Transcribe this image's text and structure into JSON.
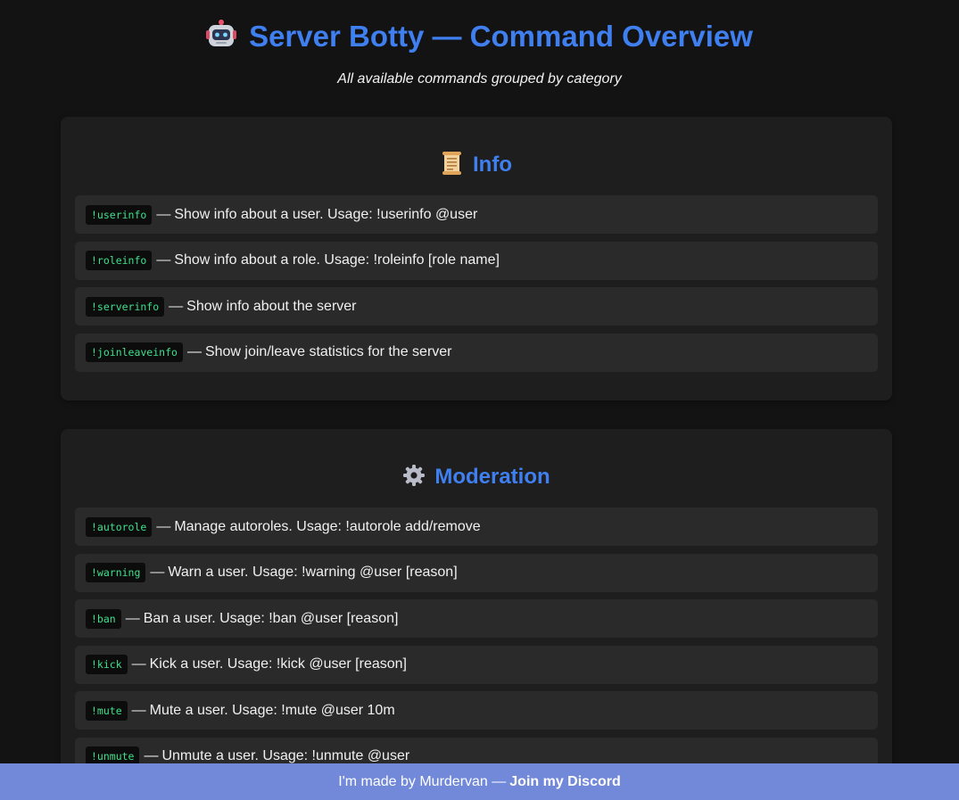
{
  "header": {
    "title": "Server Botty — Command Overview",
    "subtitle": "All available commands grouped by category",
    "icon": "robot-icon"
  },
  "sections": [
    {
      "title": "Info",
      "icon": "scroll-icon",
      "commands": [
        {
          "cmd": "!userinfo",
          "desc": "Show info about a user. Usage: !userinfo @user"
        },
        {
          "cmd": "!roleinfo",
          "desc": "Show info about a role. Usage: !roleinfo [role name]"
        },
        {
          "cmd": "!serverinfo",
          "desc": "Show info about the server"
        },
        {
          "cmd": "!joinleaveinfo",
          "desc": "Show join/leave statistics for the server"
        }
      ]
    },
    {
      "title": "Moderation",
      "icon": "gear-icon",
      "commands": [
        {
          "cmd": "!autorole",
          "desc": "Manage autoroles. Usage: !autorole add/remove"
        },
        {
          "cmd": "!warning",
          "desc": "Warn a user. Usage: !warning @user [reason]"
        },
        {
          "cmd": "!ban",
          "desc": "Ban a user. Usage: !ban @user [reason]"
        },
        {
          "cmd": "!kick",
          "desc": "Kick a user. Usage: !kick @user [reason]"
        },
        {
          "cmd": "!mute",
          "desc": "Mute a user. Usage: !mute @user 10m"
        },
        {
          "cmd": "!unmute",
          "desc": "Unmute a user. Usage: !unmute @user"
        }
      ]
    }
  ],
  "dash": "—",
  "footer": {
    "text": "I'm made by Murdervan —",
    "link": "Join my Discord"
  },
  "colors": {
    "accent": "#3f7ff0",
    "command": "#3ee08a",
    "footer_bg": "#7289da",
    "background": "#131313"
  }
}
